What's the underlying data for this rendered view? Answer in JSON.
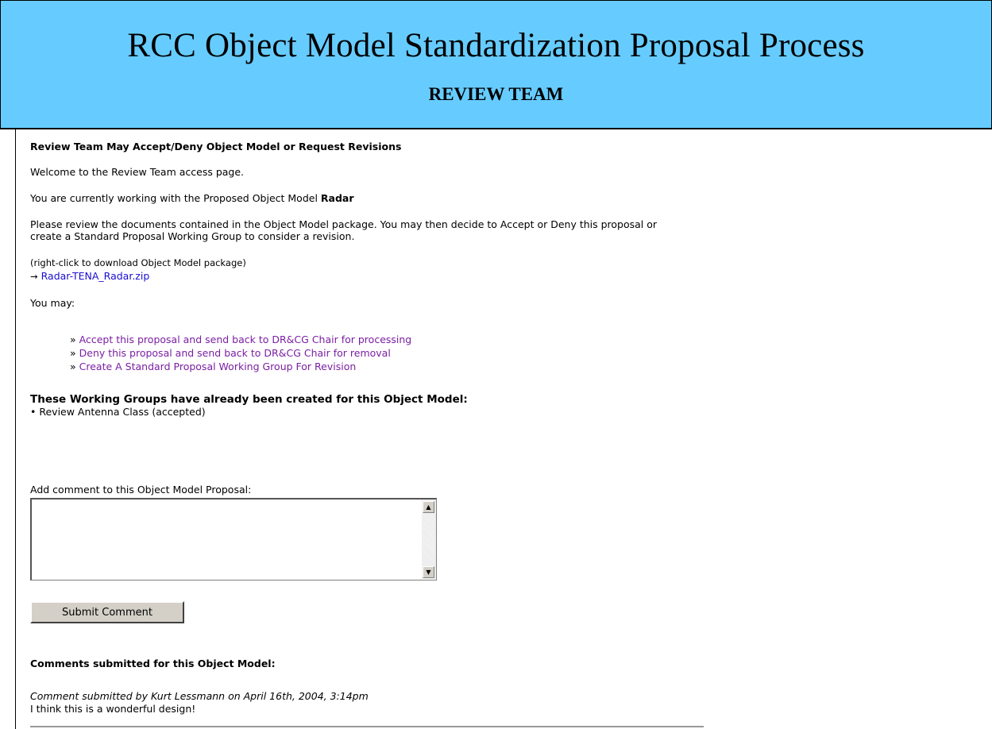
{
  "banner": {
    "title": "RCC Object Model Standardization Proposal Process",
    "subtitle": "REVIEW TEAM"
  },
  "page": {
    "section_heading": "Review Team May Accept/Deny Object Model or Request Revisions",
    "welcome": "Welcome to the Review Team access page.",
    "working_with_prefix": "You are currently working with the Proposed Object Model ",
    "model_name": "Radar",
    "instructions_line1": "Please review the documents contained in the Object Model package. You may then decide to Accept or Deny this proposal or",
    "instructions_line2": "create a Standard Proposal Working Group to consider a revision.",
    "download_hint": "(right-click to download Object Model package)",
    "download_arrow": "→",
    "download_link": "Radar-TENA_Radar.zip",
    "you_may": "You may:"
  },
  "actions": [
    {
      "bullet": "»",
      "label": "Accept this proposal and send back to DR&CG Chair for processing"
    },
    {
      "bullet": "»",
      "label": "Deny this proposal and send back to DR&CG Chair for removal"
    },
    {
      "bullet": "»",
      "label": "Create A Standard Proposal Working Group For Revision"
    }
  ],
  "working_groups": {
    "heading": "These Working Groups have already been created for this Object Model:",
    "items": [
      {
        "bullet": "•",
        "label": "Review Antenna Class (accepted)"
      }
    ]
  },
  "comment_form": {
    "label": "Add comment to this Object Model Proposal:",
    "value": "",
    "submit_label": "Submit Comment"
  },
  "comments": {
    "heading": "Comments submitted for this Object Model:",
    "items": [
      {
        "meta": "Comment submitted by Kurt Lessmann on April 16th, 2004, 3:14pm",
        "text": "I think this is a wonderful design!"
      }
    ]
  },
  "colors": {
    "banner_bg": "#66ccff",
    "link": "#1a0dd0",
    "visited_link": "#7a1fa2"
  }
}
